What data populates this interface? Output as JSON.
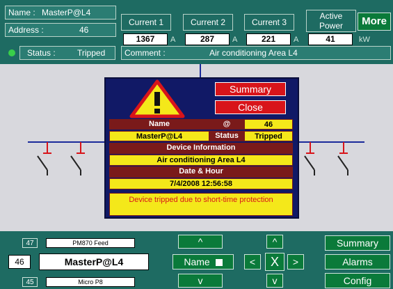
{
  "header": {
    "name_label": "Name :",
    "name_value": "MasterP@L4",
    "address_label": "Address :",
    "address_value": "46",
    "status_label": "Status :",
    "status_value": "Tripped",
    "comment_label": "Comment :",
    "comment_value": "Air conditioning Area L4",
    "current1_label": "Current 1",
    "current1_value": "1367",
    "current2_label": "Current 2",
    "current2_value": "287",
    "current3_label": "Current 3",
    "current3_value": "221",
    "current_unit": "A",
    "power_label": "Active Power",
    "power_value": "41",
    "power_unit": "kW",
    "more_label": "More"
  },
  "popup": {
    "summary_label": "Summary",
    "close_label": "Close",
    "name_header": "Name",
    "at_header": "@",
    "address_value": "46",
    "name_value": "MasterP@L4",
    "status_label": "Status",
    "status_value": "Tripped",
    "device_info_header": "Device Information",
    "device_info_value": "Air conditioning Area L4",
    "date_header": "Date & Hour",
    "date_value": "7/4/2008 12:56:58",
    "message": "Device tripped due to short-time protection"
  },
  "bottom": {
    "prev_num": "47",
    "prev_name": "PM870 Feed",
    "cur_num": "46",
    "cur_name": "MasterP@L4",
    "next_num": "45",
    "next_name": "Micro P8",
    "up_label": "^",
    "name_label": "Name",
    "down_label": "v",
    "nav_up": "^",
    "nav_left": "<",
    "nav_x": "X",
    "nav_right": ">",
    "nav_down": "v",
    "summary_label": "Summary",
    "alarms_label": "Alarms",
    "config_label": "Config"
  },
  "colors": {
    "background": "#1e6b62",
    "button_green": "#0a7a3a",
    "popup_blue": "#111966",
    "alarm_red": "#d8141a",
    "highlight_yellow": "#f4e81a"
  }
}
